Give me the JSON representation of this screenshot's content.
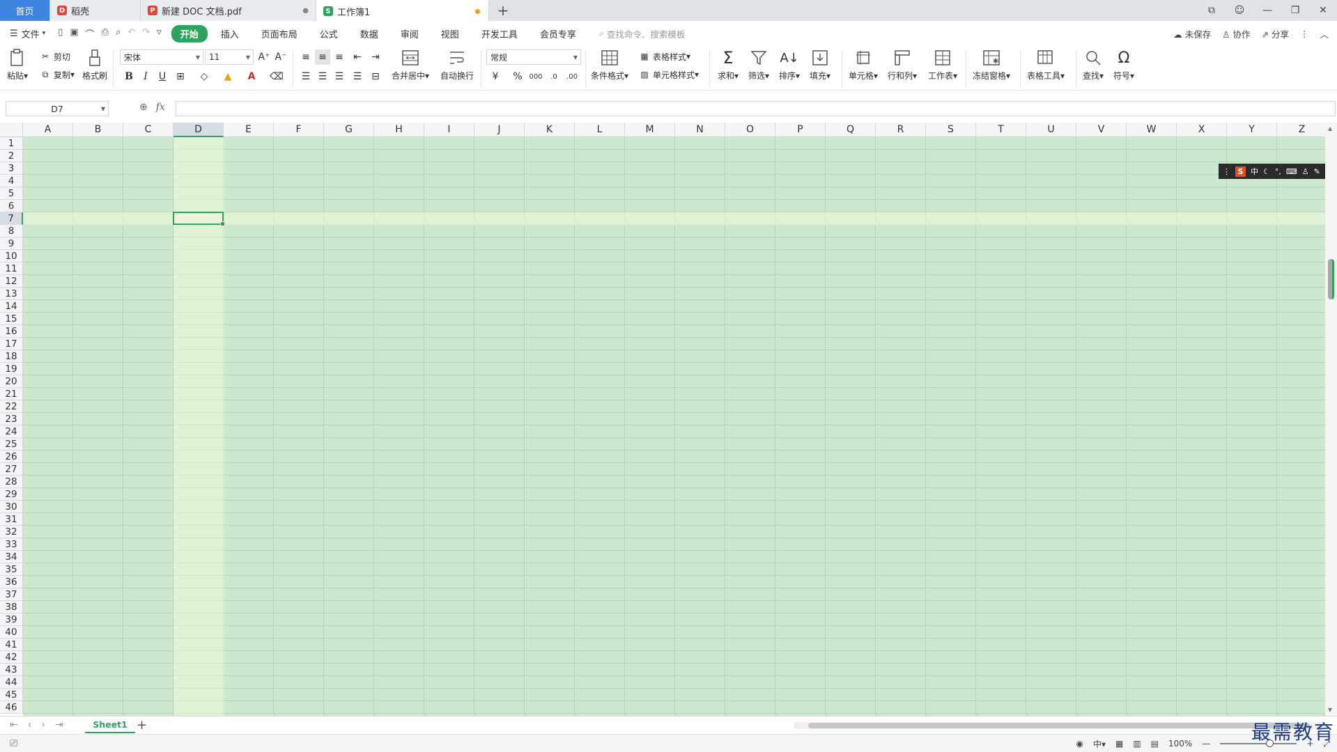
{
  "tabs": [
    {
      "label": "首页"
    },
    {
      "label": "稻壳"
    },
    {
      "label": "新建 DOC 文档.pdf"
    },
    {
      "label": "工作簿1"
    }
  ],
  "menu": {
    "file": "文件",
    "tabs": [
      "开始",
      "插入",
      "页面布局",
      "公式",
      "数据",
      "审阅",
      "视图",
      "开发工具",
      "会员专享"
    ],
    "search_placeholder": "查找命令、搜索模板",
    "unsaved": "未保存",
    "collab": "协作",
    "share": "分享"
  },
  "ribbon": {
    "paste": "粘贴",
    "cut": "剪切",
    "copy": "复制",
    "format_painter": "格式刷",
    "font_name": "宋体",
    "font_size": "11",
    "merge_center": "合并居中",
    "wrap_text": "自动换行",
    "number_format": "常规",
    "cond_format": "条件格式",
    "table_style": "表格样式",
    "cell_style": "单元格样式",
    "sum": "求和",
    "filter": "筛选",
    "sort": "排序",
    "fill": "填充",
    "cells": "单元格",
    "row_col": "行和列",
    "worksheet": "工作表",
    "freeze": "冻结窗格",
    "table_tools": "表格工具",
    "find": "查找",
    "symbol": "符号"
  },
  "formula_bar": {
    "name_box": "D7",
    "formula": ""
  },
  "grid": {
    "columns": [
      "A",
      "B",
      "C",
      "D",
      "E",
      "F",
      "G",
      "H",
      "I",
      "J",
      "K",
      "L",
      "M",
      "N",
      "O",
      "P",
      "Q",
      "R",
      "S",
      "T",
      "U",
      "V",
      "W",
      "X",
      "Y",
      "Z"
    ],
    "rows": [
      "1",
      "2",
      "3",
      "4",
      "5",
      "6",
      "7",
      "8",
      "9",
      "10",
      "11",
      "12",
      "13",
      "14",
      "15",
      "16",
      "17",
      "18",
      "19",
      "20",
      "21",
      "22",
      "23",
      "24",
      "25",
      "26",
      "27",
      "28",
      "29",
      "30",
      "31",
      "32",
      "33",
      "34",
      "35",
      "36",
      "37",
      "38",
      "39",
      "40",
      "41",
      "42",
      "43",
      "44",
      "45",
      "46"
    ],
    "active_cell": "D7"
  },
  "sheets": [
    {
      "label": "Sheet1"
    }
  ],
  "status": {
    "zoom": "100%"
  },
  "ime": {
    "mode": "中"
  },
  "watermark": "最需教育",
  "colors": {
    "accent": "#2ea35b",
    "cell_bg": "#cce8cf",
    "home_tab": "#3d83e0"
  }
}
